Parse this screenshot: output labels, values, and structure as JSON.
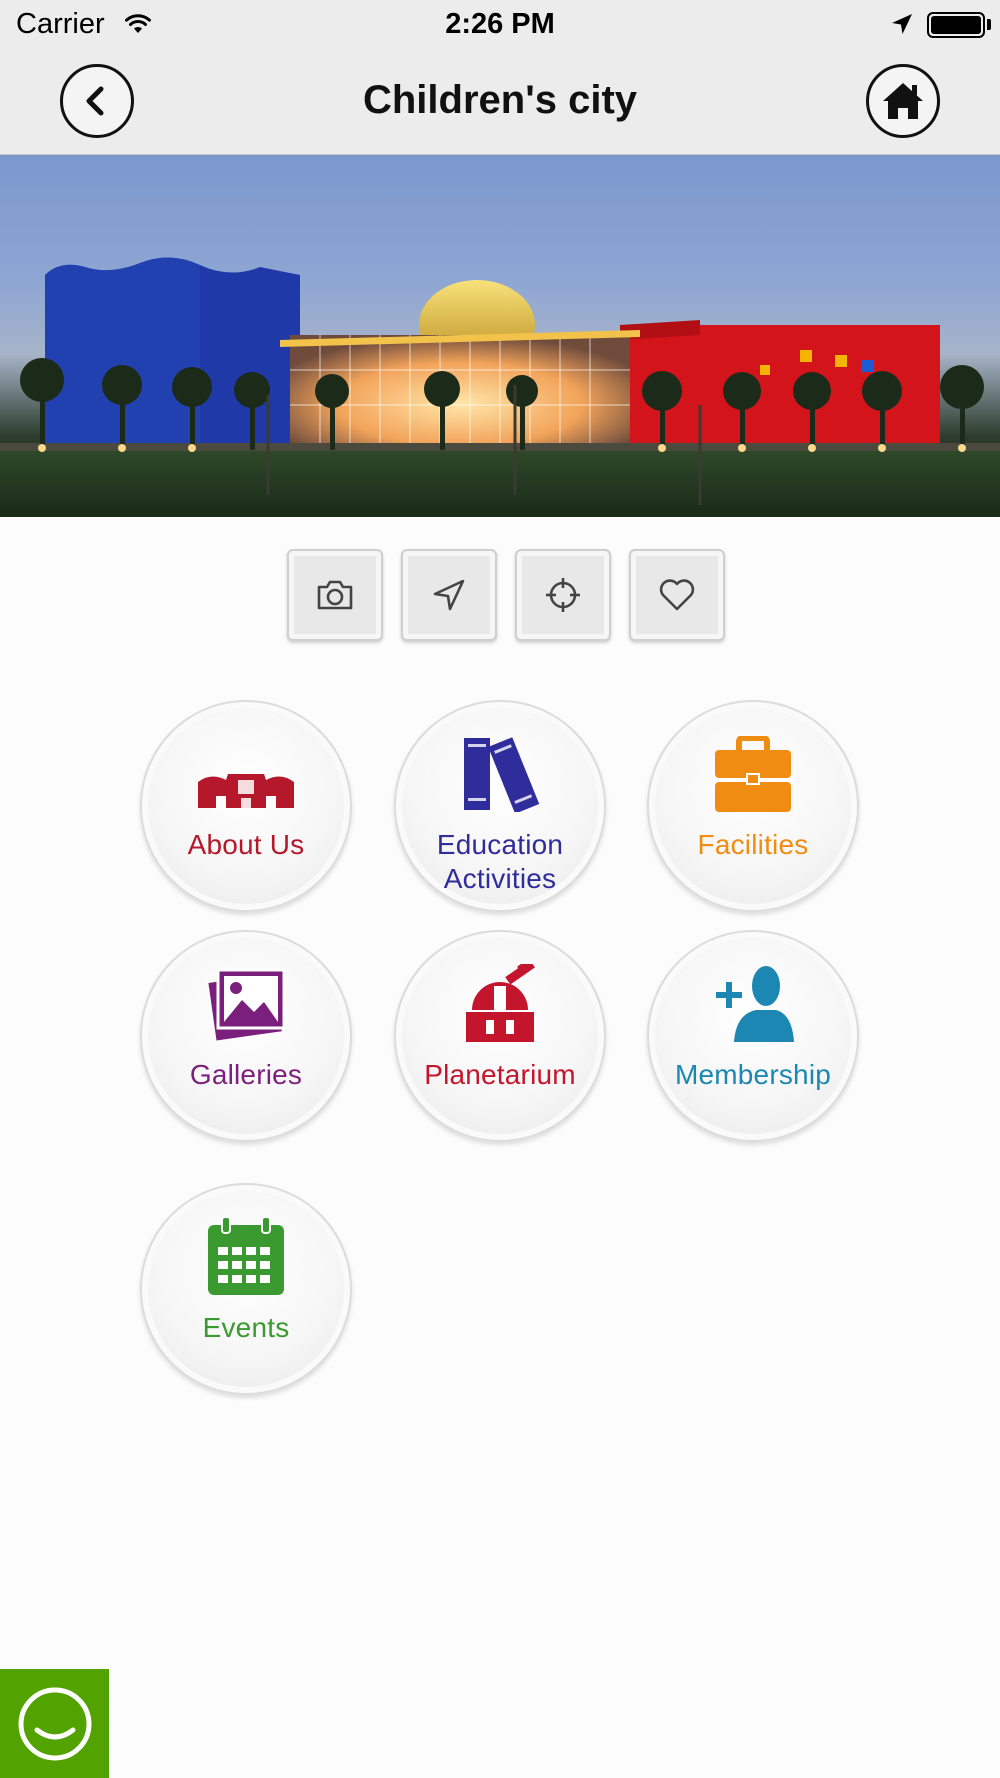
{
  "status_bar": {
    "carrier": "Carrier",
    "time": "2:26 PM"
  },
  "header": {
    "title": "Children's city",
    "back_icon": "chevron-left-icon",
    "home_icon": "home-icon"
  },
  "hero": {
    "description_icon": "building-photo"
  },
  "action_bar": [
    {
      "icon": "camera-icon"
    },
    {
      "icon": "navigation-arrow-icon"
    },
    {
      "icon": "crosshair-icon"
    },
    {
      "icon": "heart-icon"
    }
  ],
  "menu": [
    {
      "label": "About Us",
      "icon": "building-icon",
      "color": "#b5172b"
    },
    {
      "label_line1": "Education",
      "label_line2": "Activities",
      "icon": "books-icon",
      "color": "#2f2c9b"
    },
    {
      "label": "Facilities",
      "icon": "briefcase-icon",
      "color": "#f18c12"
    },
    {
      "label": "Galleries",
      "icon": "photos-icon",
      "color": "#7b1f7d"
    },
    {
      "label": "Planetarium",
      "icon": "observatory-icon",
      "color": "#c3162d"
    },
    {
      "label": "Membership",
      "icon": "add-user-icon",
      "color": "#1b87b2"
    },
    {
      "label": "Events",
      "icon": "calendar-icon",
      "color": "#3a9a2f"
    }
  ],
  "chat": {
    "icon": "chat-smile-icon",
    "color": "#52a200"
  }
}
